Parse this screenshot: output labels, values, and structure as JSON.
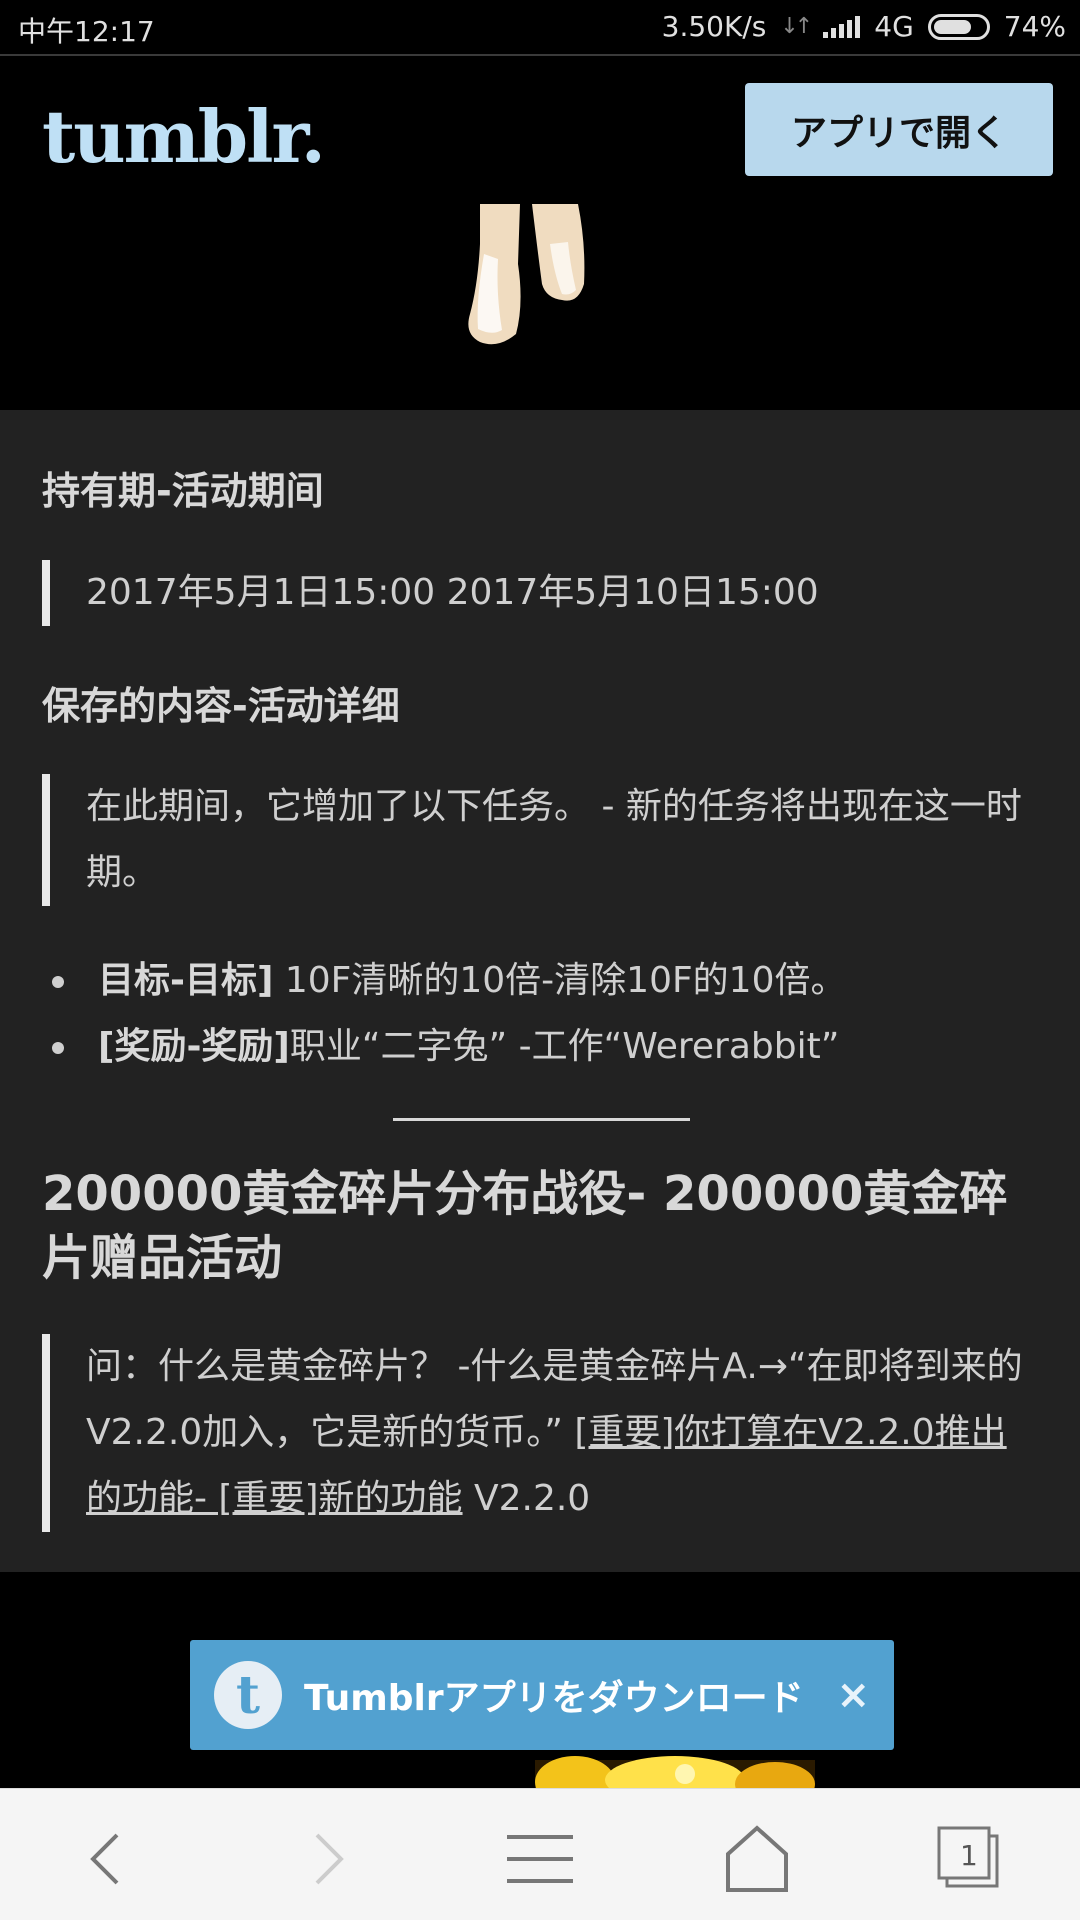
{
  "status_bar": {
    "time": "中午12:17",
    "network_speed": "3.50K/s",
    "network_type": "4G",
    "battery": "74%"
  },
  "header": {
    "logo": "tumblr.",
    "open_app_label": "アプリで開く"
  },
  "post": {
    "heading1": "持有期-活动期间",
    "quote1": "2017年5月1日15:00 2017年5月10日15:00",
    "heading2": "保存的内容-活动详细",
    "quote2": "在此期间，它增加了以下任务。 - 新的任务将出现在这一时期。",
    "bullets": [
      {
        "bold": "目标-目标]",
        "text": " 10F清晰的10倍-清除10F的10倍。"
      },
      {
        "bold": "[奖励-奖励]",
        "text": "职业“二字兔” -工作“Wererabbit”"
      }
    ],
    "heading3": "200000黄金碎片分布战役- 200000黄金碎片赠品活动",
    "quote3_text": "问：什么是黄金碎片？ -什么是黄金碎片A.→“在即将到来的V2.2.0加入，它是新的货币。” ",
    "quote3_link": "[重要]你打算在V2.2.0推出的功能- [重要]新的功能",
    "quote3_tail": " V2.2.0"
  },
  "banner": {
    "icon_letter": "t",
    "label": "Tumblrアプリをダウンロード",
    "close": "×"
  },
  "bottom_nav": {
    "tab_count": "1"
  }
}
